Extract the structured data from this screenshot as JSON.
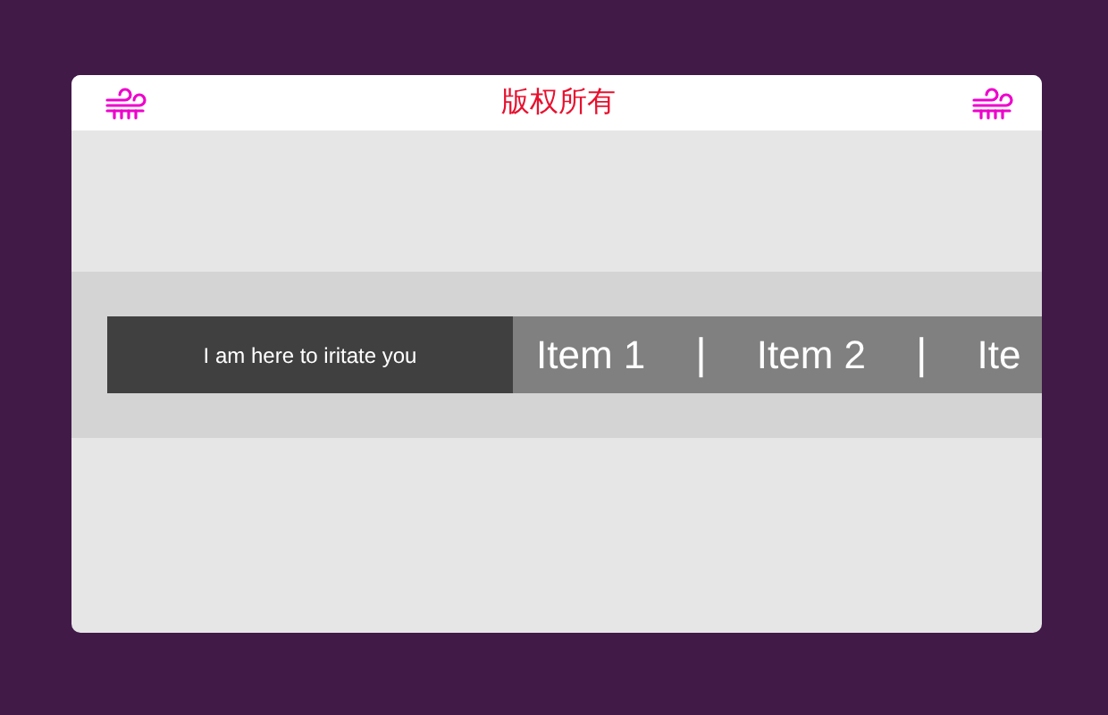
{
  "header": {
    "title": "版权所有"
  },
  "banner": {
    "message": "I am here to iritate you",
    "items": [
      {
        "kind": "item",
        "label": "Item 1"
      },
      {
        "kind": "separator",
        "label": "|"
      },
      {
        "kind": "item",
        "label": "Item 2"
      },
      {
        "kind": "separator",
        "label": "|"
      },
      {
        "kind": "item",
        "label": "Ite"
      }
    ]
  }
}
